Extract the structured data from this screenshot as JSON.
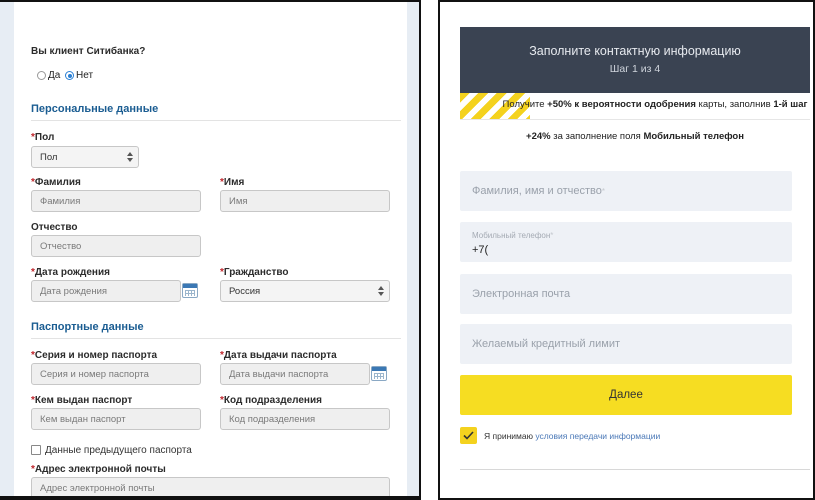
{
  "left": {
    "client_question": "Вы клиент Ситибанка?",
    "radio_yes": "Да",
    "radio_no": "Нет",
    "section_personal": "Персональные данные",
    "gender_label": "Пол",
    "gender_value": "Пол",
    "surname_label": "Фамилия",
    "surname_placeholder": "Фамилия",
    "name_label": "Имя",
    "name_placeholder": "Имя",
    "patronymic_label": "Отчество",
    "patronymic_placeholder": "Отчество",
    "birthdate_label": "Дата рождения",
    "birthdate_placeholder": "Дата рождения",
    "citizenship_label": "Гражданство",
    "citizenship_value": "Россия",
    "section_passport": "Паспортные данные",
    "passport_number_label": "Серия и номер паспорта",
    "passport_number_placeholder": "Серия и номер паспорта",
    "passport_date_label": "Дата выдачи паспорта",
    "passport_date_placeholder": "Дата выдачи паспорта",
    "issued_by_label": "Кем выдан паспорт",
    "issued_by_placeholder": "Кем выдан паспорт",
    "division_code_label": "Код подразделения",
    "division_code_placeholder": "Код подразделения",
    "previous_passport_label": "Данные предыдущего паспорта",
    "email_label": "Адрес электронной почты",
    "email_placeholder": "Адрес электронной почты",
    "required_mark": "*"
  },
  "right": {
    "header_title": "Заполните контактную информацию",
    "header_step": "Шаг 1 из 4",
    "promo1_pre": "Получите ",
    "promo1_bold1": "+50% к вероятности одобрения",
    "promo1_mid": " карты, заполнив ",
    "promo1_bold2": "1-й шаг",
    "promo2_bold1": "+24%",
    "promo2_mid": " за заполнение поля ",
    "promo2_bold2": "Мобильный телефон",
    "fio_placeholder": "Фамилия, имя и отчество",
    "phone_label": "Мобильный телефон",
    "phone_value": "+7(",
    "email_placeholder": "Электронная почта",
    "limit_placeholder": "Желаемый кредитный лимит",
    "next_button": "Далее",
    "agree_text": "Я принимаю ",
    "agree_link": "условия передачи информации",
    "star": "*"
  },
  "colors": {
    "section_blue": "#1b5d92",
    "required_red": "#c0272d",
    "header_dark": "#3a4352",
    "accent_yellow": "#f6dd22",
    "field_bg": "#eef1f6"
  }
}
